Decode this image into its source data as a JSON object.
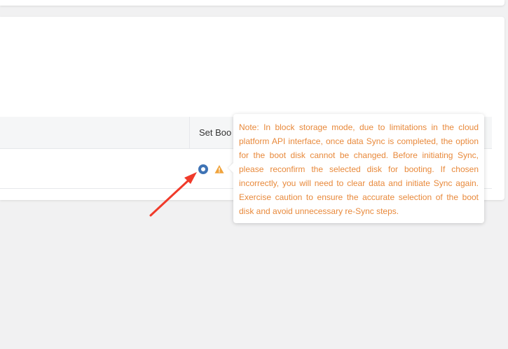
{
  "table": {
    "header": {
      "set_boot_label": "Set Boo"
    },
    "row": {
      "boot_radio_selected": true
    }
  },
  "tooltip": {
    "note": "Note: In block storage mode, due to limitations in the cloud platform API interface, once data Sync is completed, the option for the boot disk cannot be changed. Before initiating Sync, please reconfirm the selected disk for booting. If chosen incorrectly, you will need to clear data and initiate Sync again. Exercise caution to ensure the accurate selection of the boot disk and avoid unnecessary re-Sync steps."
  },
  "colors": {
    "radio_accent": "#3f73b5",
    "warning": "#f0a33c",
    "tooltip_text": "#e8893b",
    "annotation_arrow": "#f03a2a"
  },
  "icons": {
    "warning": "warning-triangle-icon",
    "annotation": "red-arrow-icon"
  }
}
